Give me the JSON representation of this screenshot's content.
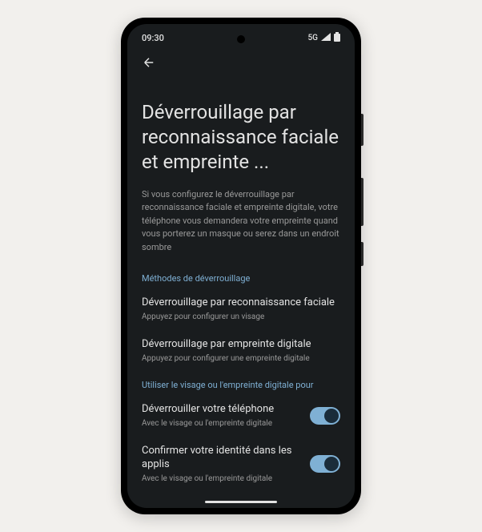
{
  "statusBar": {
    "time": "09:30",
    "network": "5G"
  },
  "page": {
    "title": "Déverrouillage par reconnaissance faciale et empreinte ...",
    "description": "Si vous configurez le déverrouillage par reconnaissance faciale et empreinte digitale, votre téléphone vous demandera votre empreinte quand vous porterez un masque ou serez dans un endroit sombre"
  },
  "sections": {
    "unlockMethods": {
      "header": "Méthodes de déverrouillage",
      "items": [
        {
          "title": "Déverrouillage par reconnaissance faciale",
          "subtitle": "Appuyez pour configurer un visage"
        },
        {
          "title": "Déverrouillage par empreinte digitale",
          "subtitle": "Appuyez pour configurer une empreinte digitale"
        }
      ]
    },
    "usage": {
      "header": "Utiliser le visage ou l'empreinte digitale pour",
      "items": [
        {
          "title": "Déverrouiller votre téléphone",
          "subtitle": "Avec le visage ou l'empreinte digitale",
          "enabled": true
        },
        {
          "title": "Confirmer votre identité dans les applis",
          "subtitle": "Avec le visage ou l'empreinte digitale",
          "enabled": true
        }
      ]
    }
  }
}
